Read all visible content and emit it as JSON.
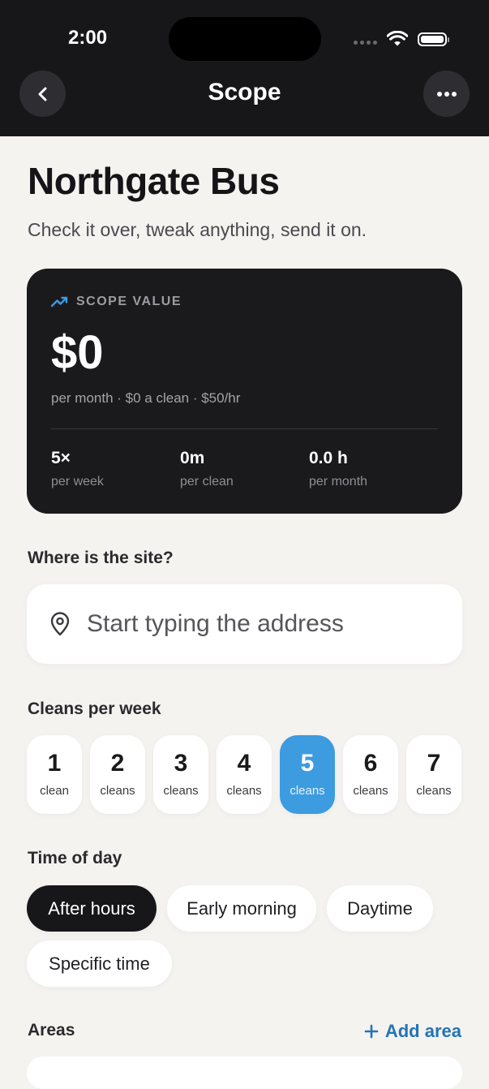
{
  "status_bar": {
    "time": "2:00"
  },
  "nav": {
    "title": "Scope",
    "back_icon": "chevron-left-icon",
    "more_icon": "ellipsis-icon"
  },
  "header": {
    "title": "Northgate Bus",
    "subtitle": "Check it over, tweak anything, send it on."
  },
  "scope_card": {
    "label": "SCOPE VALUE",
    "label_icon": "trending-up-icon",
    "accent_color": "#3D9BE0",
    "value": "$0",
    "summary": "per month · $0 a clean · $50/hr",
    "stats": [
      {
        "value": "5×",
        "label": "per week"
      },
      {
        "value": "0m",
        "label": "per clean"
      },
      {
        "value": "0.0 h",
        "label": "per month"
      }
    ]
  },
  "site": {
    "label": "Where is the site?",
    "placeholder": "Start typing the address",
    "value": "",
    "icon": "map-pin-icon"
  },
  "cleans_per_week": {
    "label": "Cleans per week",
    "selected": "5",
    "selected_color": "#3D9BE0",
    "options": [
      {
        "num": "1",
        "unit": "clean"
      },
      {
        "num": "2",
        "unit": "cleans"
      },
      {
        "num": "3",
        "unit": "cleans"
      },
      {
        "num": "4",
        "unit": "cleans"
      },
      {
        "num": "5",
        "unit": "cleans"
      },
      {
        "num": "6",
        "unit": "cleans"
      },
      {
        "num": "7",
        "unit": "cleans"
      }
    ]
  },
  "time_of_day": {
    "label": "Time of day",
    "selected": "After hours",
    "options": [
      "After hours",
      "Early morning",
      "Daytime",
      "Specific time"
    ]
  },
  "areas": {
    "label": "Areas",
    "add_label": "Add area",
    "add_icon": "plus-icon",
    "link_color": "#2474B5"
  }
}
